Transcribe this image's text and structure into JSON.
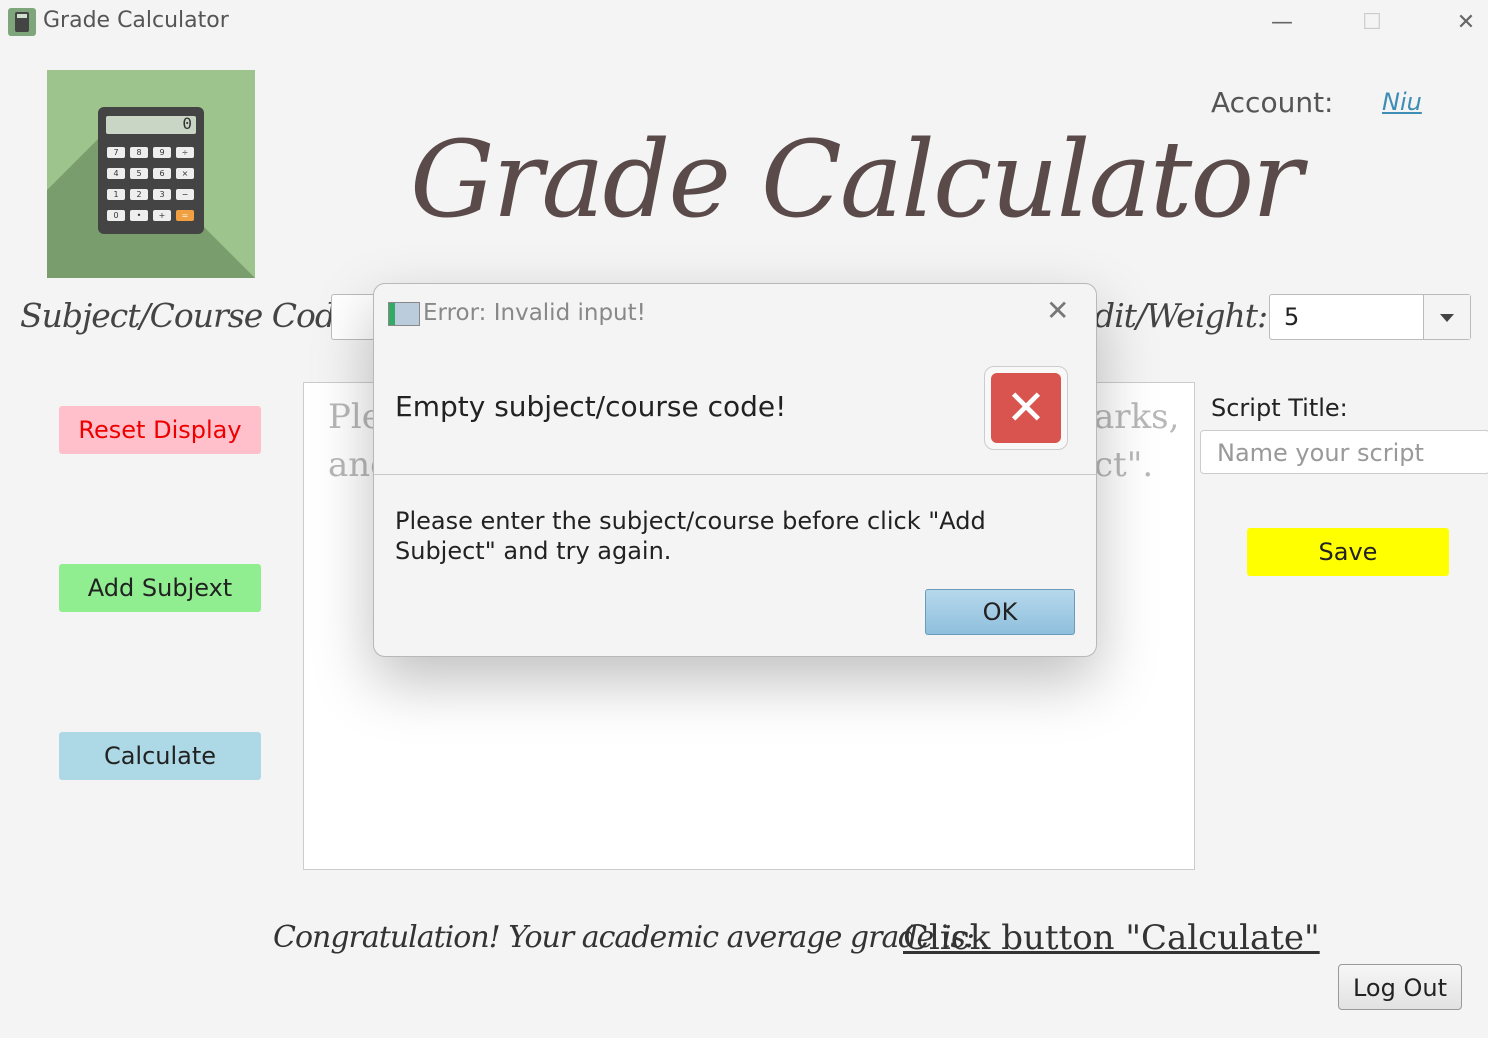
{
  "window": {
    "title": "Grade Calculator",
    "minimize": "—",
    "maximize": "☐",
    "close": "✕"
  },
  "logo": {
    "digit": "0",
    "keys": [
      "7",
      "8",
      "9",
      "÷",
      "4",
      "5",
      "6",
      "×",
      "1",
      "2",
      "3",
      "−",
      "0",
      "•",
      "+",
      "="
    ]
  },
  "header": {
    "title": "Grade Calculator",
    "account_label": "Account:",
    "account_name": "Niu"
  },
  "form": {
    "subject_label": "Subject/Course Code:",
    "weight_label": "dit/Weight:",
    "weight_value": "5"
  },
  "sidebar": {
    "reset": "Reset Display",
    "add": "Add Subjext",
    "calculate": "Calculate"
  },
  "display": {
    "line1_left": "Ple",
    "line1_right": "arks,",
    "line2_left": "anc",
    "line2_right": "ct\"."
  },
  "script": {
    "label": "Script Title:",
    "placeholder": "Name your script",
    "save": "Save"
  },
  "footer": {
    "average_label": "Congratulation! Your academic average grade is:",
    "average_value": "Click button \"Calculate\"",
    "logout": "Log Out"
  },
  "dialog": {
    "title": "Error: Invalid input!",
    "close": "✕",
    "header": "Empty subject/course code!",
    "icon": "✕",
    "message": "Please enter the subject/course before click \"Add Subject\" and try again.",
    "ok": "OK"
  },
  "colors": {
    "reset_bg": "#ffc0cb",
    "add_bg": "#90ee90",
    "calculate_bg": "#add8e6",
    "save_bg": "#ffff00",
    "error_red": "#d9534f"
  }
}
